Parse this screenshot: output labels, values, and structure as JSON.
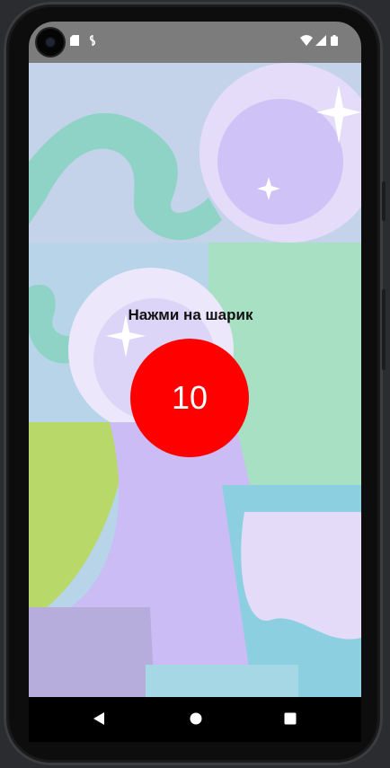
{
  "status_bar": {
    "icons": [
      "camera-cutout",
      "sd-card-icon",
      "sync-icon",
      "wifi-icon",
      "signal-icon",
      "battery-icon"
    ],
    "background": "#7c7c7c"
  },
  "main": {
    "prompt": "Нажми на шарик",
    "ball": {
      "count": "10",
      "color": "#ff0000"
    },
    "background_palette": [
      "#c5d3ea",
      "#8fd3c6",
      "#cbbcf5",
      "#b8d86a",
      "#8ccfe0",
      "#a7e0c2"
    ]
  },
  "nav_bar": {
    "buttons": [
      "back-icon",
      "home-icon",
      "recents-icon"
    ]
  }
}
